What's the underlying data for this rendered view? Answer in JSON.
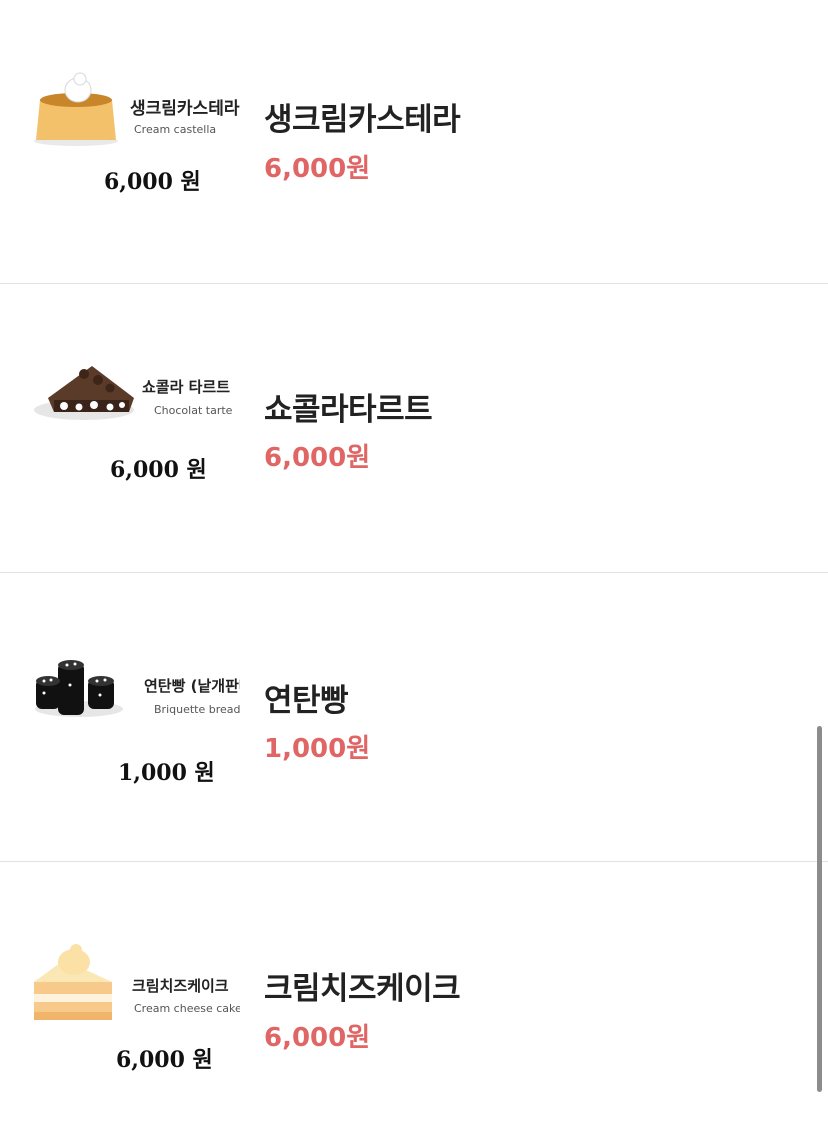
{
  "menu": {
    "items": [
      {
        "name": "생크림카스테라",
        "price": "6,000원",
        "thumb_name": "생크림카스테라",
        "thumb_en": "Cream castella",
        "thumb_price": "6,000 원"
      },
      {
        "name": "쇼콜라타르트",
        "price": "6,000원",
        "thumb_name": "쇼콜라 타르트",
        "thumb_en": "Chocolat tarte",
        "thumb_price": "6,000 원"
      },
      {
        "name": "연탄빵",
        "price": "1,000원",
        "thumb_name": "연탄빵 (낱개판매)",
        "thumb_en": "Briquette bread",
        "thumb_price": "1,000 원"
      },
      {
        "name": "크림치즈케이크",
        "price": "6,000원",
        "thumb_name": "크림치즈케이크",
        "thumb_en": "Cream cheese cake",
        "thumb_price": "6,000 원"
      }
    ]
  },
  "colors": {
    "price_accent": "#e06565",
    "divider": "#e2e2e2",
    "scrollbar": "#8c8c8c"
  },
  "icons": [
    "castella-image",
    "chocolate-tart-image",
    "briquette-bread-image",
    "cheesecake-image"
  ]
}
